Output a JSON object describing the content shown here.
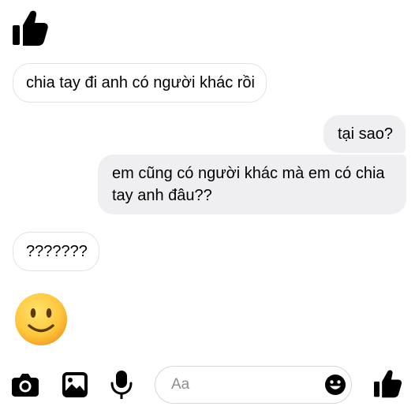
{
  "messages": [
    {
      "direction": "incoming",
      "type": "like-icon"
    },
    {
      "direction": "incoming",
      "text": "chia tay đi anh có người khác rồi"
    },
    {
      "direction": "outgoing",
      "text": "tại sao?"
    },
    {
      "direction": "outgoing",
      "text": "em cũng có người khác mà em có chia tay anh đâu??"
    },
    {
      "direction": "incoming",
      "text": "???????"
    },
    {
      "direction": "incoming",
      "type": "slightly-smiling-face-emoji"
    }
  ],
  "composer": {
    "placeholder": "Aa",
    "icons": [
      "camera-icon",
      "image-icon",
      "microphone-icon",
      "emoji-icon",
      "like-icon"
    ]
  },
  "colors": {
    "text": "#000000",
    "outgoing_bubble": "#efeff1",
    "incoming_border": "#e3e3e6",
    "placeholder": "#8e8e93"
  }
}
